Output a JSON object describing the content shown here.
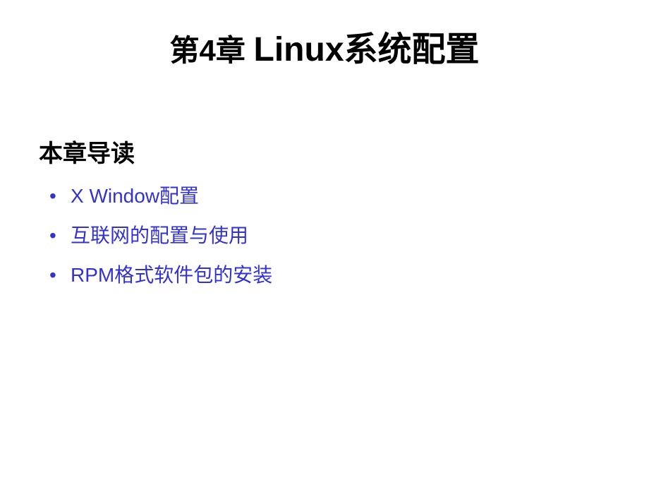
{
  "slide": {
    "title_prefix": "第4章 ",
    "title_main": "Linux系统配置",
    "section_heading": "本章导读",
    "bullets": [
      "X Window配置",
      "互联网的配置与使用",
      "RPM格式软件包的安装"
    ]
  }
}
